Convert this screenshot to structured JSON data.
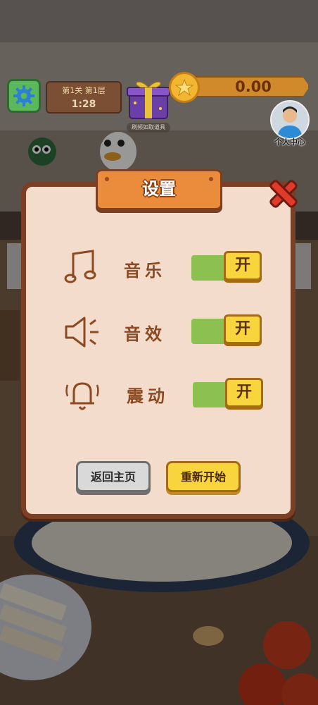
{
  "hud": {
    "level_text": "第1关 第1层",
    "timer": "1:28",
    "gift_caption": "刷频如取道具",
    "coins": "0.00",
    "avatar_label": "个人中心"
  },
  "modal": {
    "title": "设置",
    "rows": [
      {
        "icon": "music-note-icon",
        "label": "音乐",
        "toggle": "开"
      },
      {
        "icon": "speaker-icon",
        "label": "音效",
        "toggle": "开"
      },
      {
        "icon": "bell-icon",
        "label": "震动",
        "toggle": "开"
      }
    ],
    "buttons": {
      "home": "返回主页",
      "restart": "重新开始"
    }
  },
  "colors": {
    "panel_bg": "#f3dccc",
    "panel_border": "#7b3f24",
    "title_plate": "#ea8c3c",
    "toggle_on": "#8cc152",
    "toggle_knob": "#f8d53d",
    "close_red": "#e03b2a"
  }
}
